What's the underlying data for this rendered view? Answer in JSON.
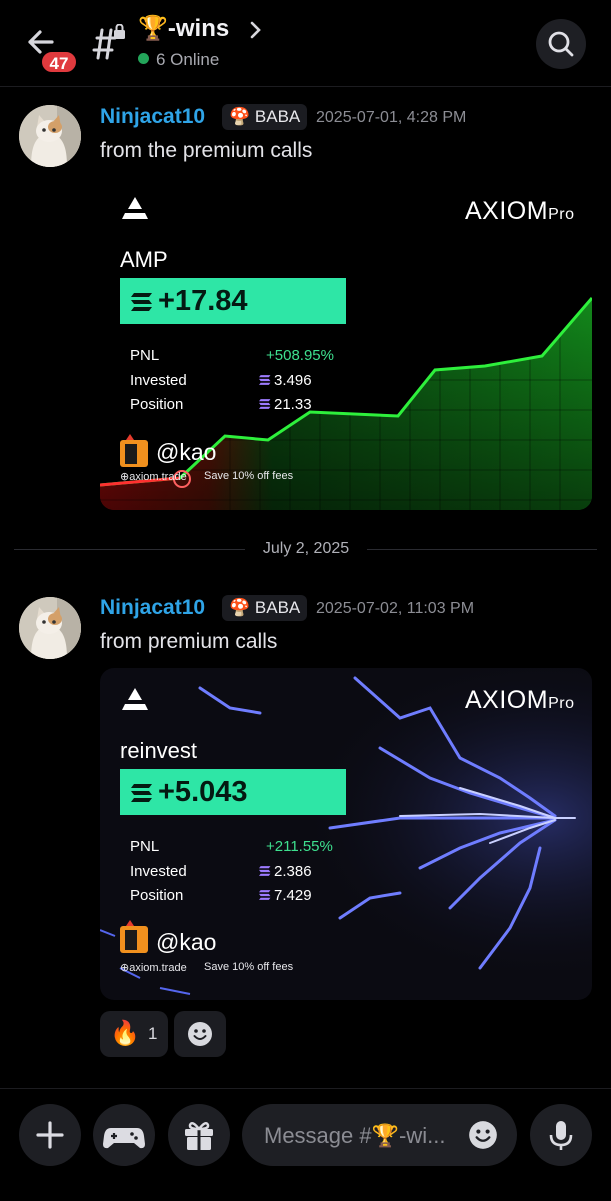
{
  "header": {
    "unread_count": "47",
    "channel_name": "🏆-wins",
    "online_text": "6 Online"
  },
  "messages": [
    {
      "username": "Ninjacat10",
      "role": "BABA",
      "timestamp": "2025-07-01, 4:28 PM",
      "text": "from the premium calls",
      "card": {
        "brand": "AXIOM",
        "brand_suffix": "Pro",
        "ticker": "AMP",
        "gain": "+17.84",
        "stats": [
          {
            "label": "PNL",
            "value": "+508.95%"
          },
          {
            "label": "Invested",
            "value": "3.496"
          },
          {
            "label": "Position",
            "value": "21.33"
          }
        ],
        "handle": "@kao",
        "footer_link": "axiom.trade",
        "footer_promo": "Save 10% off fees"
      }
    },
    {
      "username": "Ninjacat10",
      "role": "BABA",
      "timestamp": "2025-07-02, 11:03 PM",
      "text": "from premium calls",
      "card": {
        "brand": "AXIOM",
        "brand_suffix": "Pro",
        "ticker": "reinvest",
        "gain": "+5.043",
        "stats": [
          {
            "label": "PNL",
            "value": "+211.55%"
          },
          {
            "label": "Invested",
            "value": "2.386"
          },
          {
            "label": "Position",
            "value": "7.429"
          }
        ],
        "handle": "@kao",
        "footer_link": "axiom.trade",
        "footer_promo": "Save 10% off fees"
      }
    }
  ],
  "date_divider": "July 2, 2025",
  "reactions": [
    {
      "emoji": "🔥",
      "count": "1"
    }
  ],
  "composer": {
    "placeholder": "Message #🏆-wi..."
  },
  "colors": {
    "accent_username": "#2fa4e7",
    "gain_green": "#2ee6a6",
    "pnl_green": "#3ee08f",
    "badge_red": "#e03a3e",
    "online_green": "#23a55a"
  }
}
